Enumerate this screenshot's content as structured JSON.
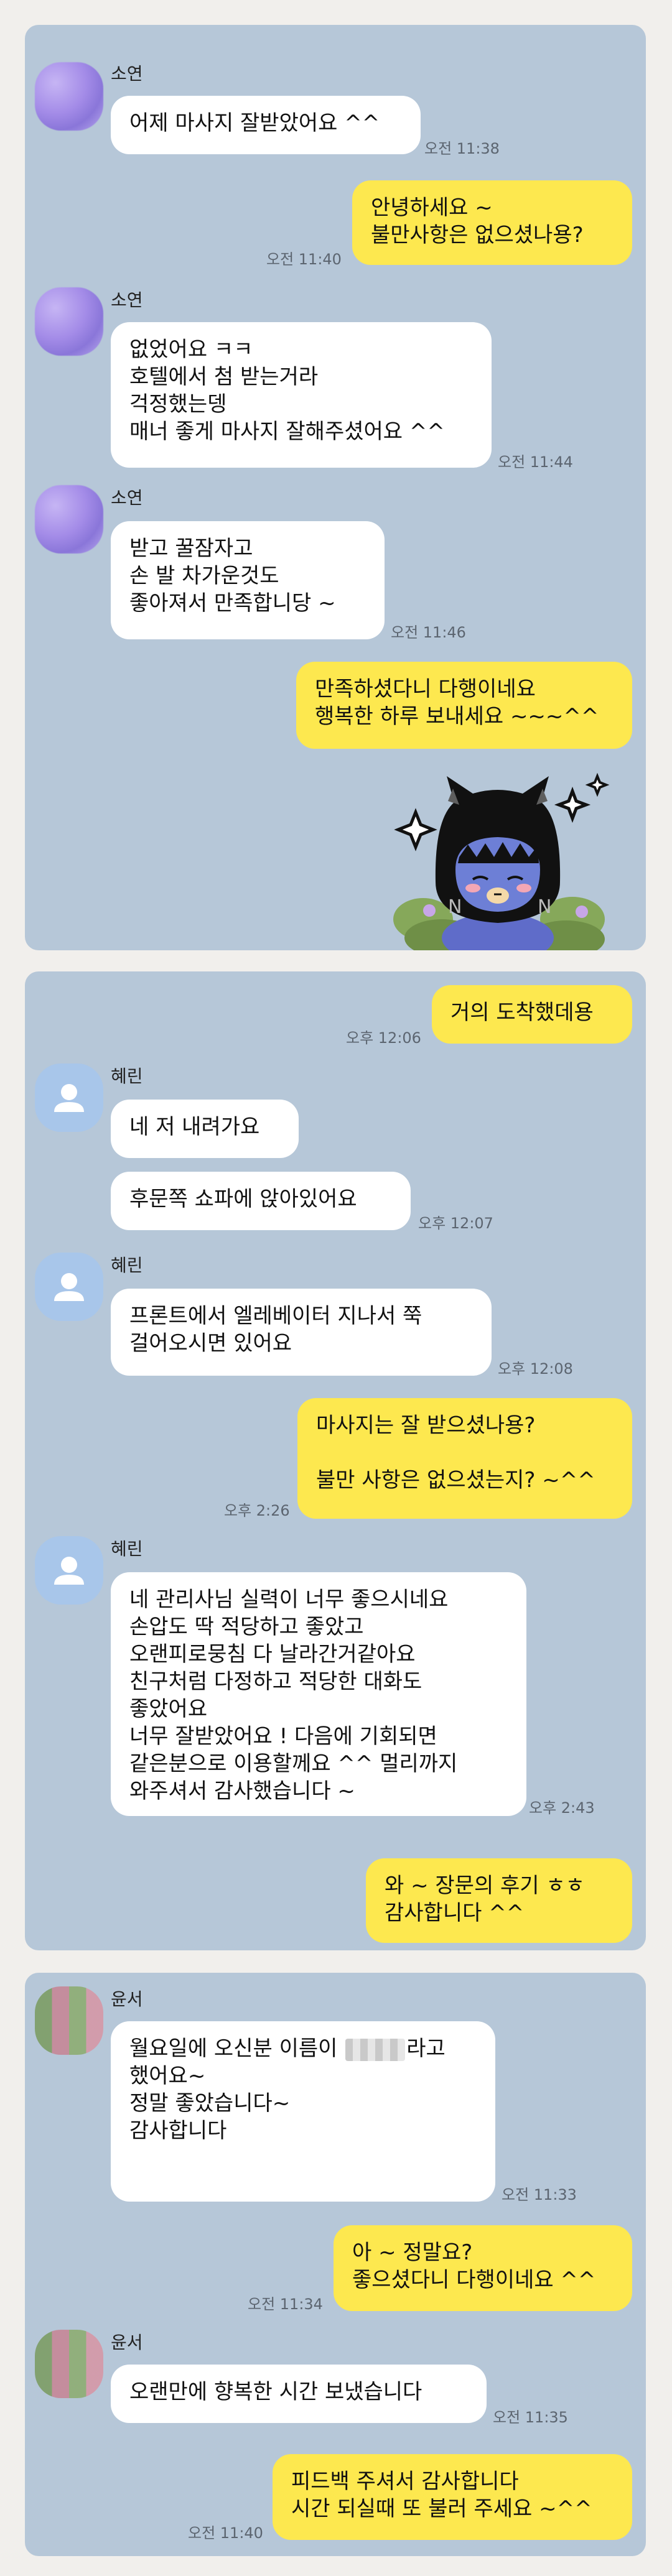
{
  "chat1": {
    "sender": "소연",
    "messages": [
      {
        "text": "어제 마사지 잘받았어요 ^^",
        "time": "오전 11:38"
      },
      {
        "text": "안녕하세요 ~\n불만사항은 없으셨나용?",
        "time": "오전 11:40"
      },
      {
        "text": "없었어요 ㅋㅋ\n호텔에서 첨 받는거라\n걱정했는뎅\n매너 좋게 마사지 잘해주셨어요 ^^",
        "time": "오전 11:44"
      },
      {
        "text": "받고 꿀잠자고\n손 발 차가운것도\n좋아져서 만족합니당 ~",
        "time": "오전 11:46"
      },
      {
        "text": "만족하셨다니 다행이네요\n행복한 하루 보내세요 ~~~^^"
      }
    ],
    "sticker": "cat-hood-character-sticker"
  },
  "chat2": {
    "sender": "혜린",
    "messages": [
      {
        "text": "거의 도착했데용",
        "time": "오후 12:06"
      },
      {
        "text": "네 저 내려가요"
      },
      {
        "text": "후문쪽 쇼파에 앉아있어요",
        "time": "오후 12:07"
      },
      {
        "text": "프론트에서 엘레베이터 지나서 쭉\n걸어오시면 있어요",
        "time": "오후 12:08"
      },
      {
        "text": "마사지는 잘 받으셨나용?\n\n불만 사항은 없으셨는지? ~^^",
        "time": "오후 2:26"
      },
      {
        "text": "네 관리사님 실력이 너무 좋으시네요\n손압도 딱 적당하고 좋았고\n오랜피로뭉침 다 날라간거같아요\n친구처럼 다정하고 적당한 대화도\n좋았어요\n너무 잘받았어요 ! 다음에 기회되면\n같은분으로 이용할께요 ^^ 멀리까지\n와주셔서 감사했습니다 ~",
        "time": "오후 2:43"
      },
      {
        "text": "와 ~ 장문의 후기 ㅎㅎ\n감사합니다 ^^"
      }
    ]
  },
  "chat3": {
    "sender": "윤서",
    "messages": [
      {
        "line1_before": "월요일에 오신분 이름이 ",
        "line1_after": "라고",
        "rest": "했어요~\n정말 좋았습니다~\n감사합니다",
        "time": "오전 11:33"
      },
      {
        "text": "아 ~ 정말요?\n좋으셨다니 다행이네요 ^^",
        "time": "오전 11:34"
      },
      {
        "text": "오랜만에 향복한 시간 보냈습니다",
        "time": "오전 11:35"
      },
      {
        "text": "피드백 주셔서 감사합니다\n시간 되실때 또 불러 주세요 ~^^",
        "time": "오전 11:40"
      }
    ]
  },
  "colors": {
    "panel": "#b6c7d8",
    "incoming": "#ffffff",
    "outgoing": "#fde84f"
  }
}
